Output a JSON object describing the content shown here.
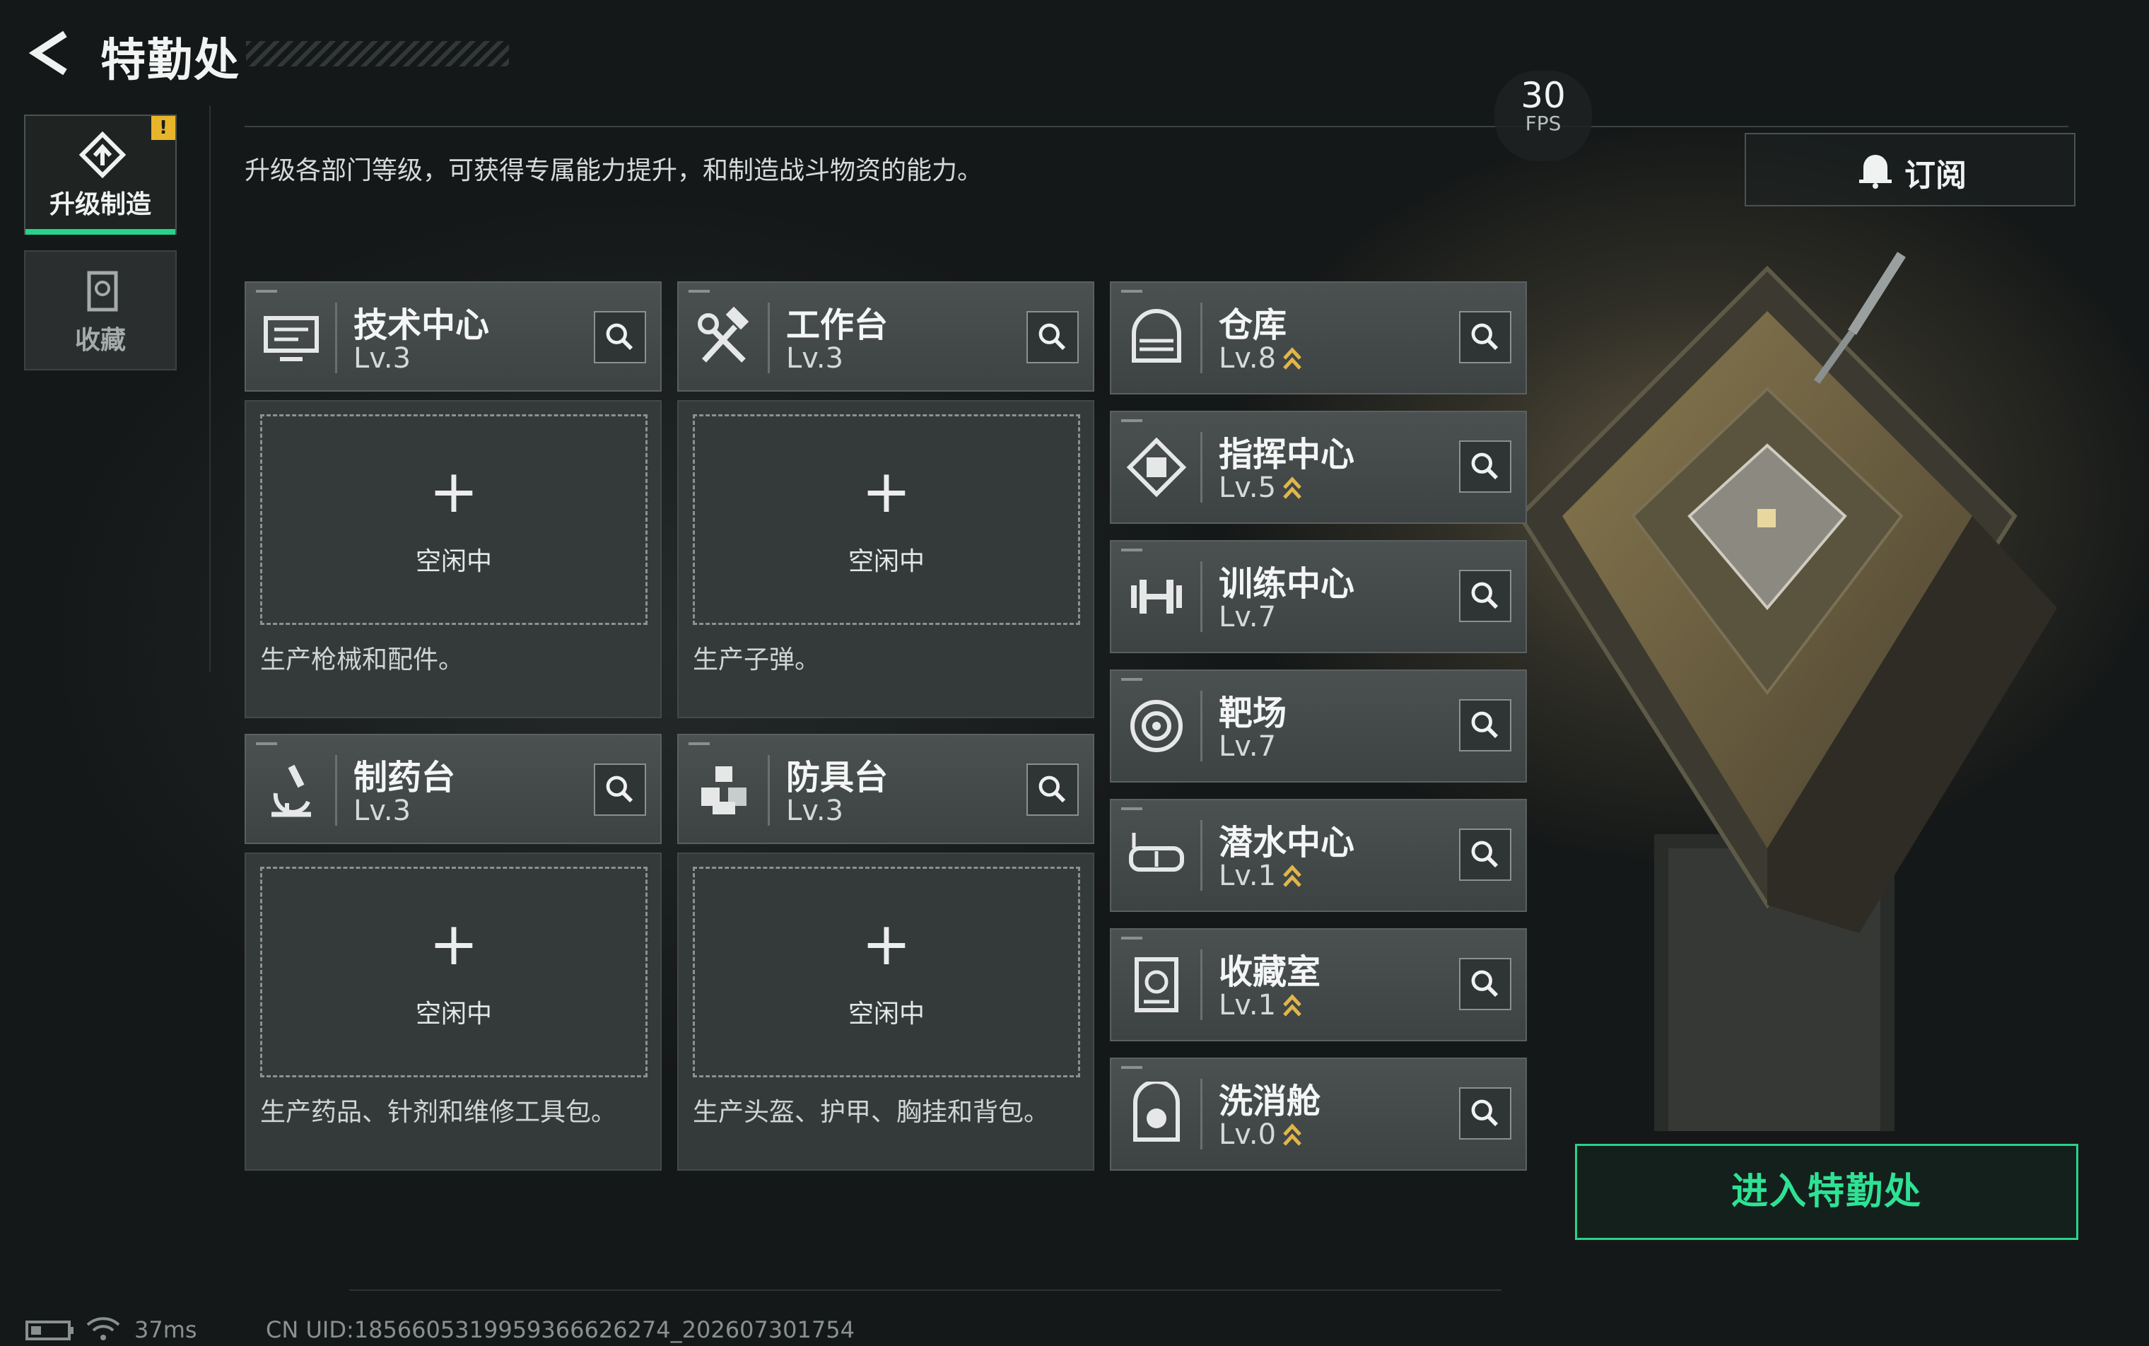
{
  "header": {
    "title": "特勤处"
  },
  "description": "升级各部门等级，可获得专属能力提升，和制造战斗物资的能力。",
  "tabs": [
    {
      "label": "升级制造",
      "active": true,
      "badge": "!"
    },
    {
      "label": "收藏",
      "active": false
    }
  ],
  "fps": {
    "value": "30",
    "label": "FPS"
  },
  "subscribe": {
    "label": "订阅"
  },
  "production_cards": [
    {
      "name": "技术中心",
      "level": "Lv.3",
      "slot_plus": "+",
      "slot_status": "空闲中",
      "desc": "生产枪械和配件。",
      "icon": "monitor-icon"
    },
    {
      "name": "工作台",
      "level": "Lv.3",
      "slot_plus": "+",
      "slot_status": "空闲中",
      "desc": "生产子弹。",
      "icon": "tools-icon"
    },
    {
      "name": "制药台",
      "level": "Lv.3",
      "slot_plus": "+",
      "slot_status": "空闲中",
      "desc": "生产药品、针剂和维修工具包。",
      "icon": "microscope-icon"
    },
    {
      "name": "防具台",
      "level": "Lv.3",
      "slot_plus": "+",
      "slot_status": "空闲中",
      "desc": "生产头盔、护甲、胸挂和背包。",
      "icon": "armor-icon"
    }
  ],
  "facilities": [
    {
      "name": "仓库",
      "level": "Lv.8",
      "upgradable": true,
      "icon": "warehouse-icon"
    },
    {
      "name": "指挥中心",
      "level": "Lv.5",
      "upgradable": true,
      "icon": "command-chip-icon"
    },
    {
      "name": "训练中心",
      "level": "Lv.7",
      "upgradable": false,
      "icon": "dumbbell-icon"
    },
    {
      "name": "靶场",
      "level": "Lv.7",
      "upgradable": false,
      "icon": "target-icon"
    },
    {
      "name": "潜水中心",
      "level": "Lv.1",
      "upgradable": true,
      "icon": "diving-mask-icon"
    },
    {
      "name": "收藏室",
      "level": "Lv.1",
      "upgradable": true,
      "icon": "collection-icon"
    },
    {
      "name": "洗消舱",
      "level": "Lv.0",
      "upgradable": true,
      "icon": "decon-icon"
    }
  ],
  "enter_button": {
    "label": "进入特勤处"
  },
  "status_bar": {
    "ping": "37ms",
    "uid": "CN UID:1856605319959366626274_202607301754"
  },
  "colors": {
    "accent_green": "#27d38a",
    "upgrade_gold": "#e0b64a",
    "warning": "#e6b52a"
  }
}
